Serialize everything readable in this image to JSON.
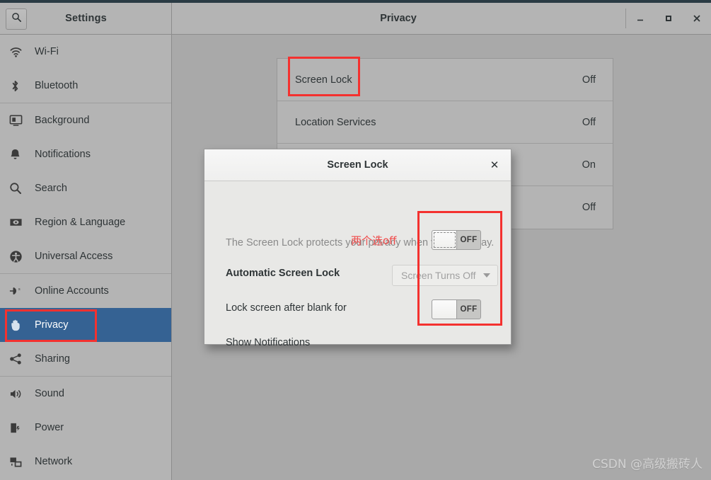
{
  "window": {
    "sidebar_title": "Settings",
    "content_title": "Privacy",
    "search_icon": "search-icon",
    "minimize_label": "–",
    "maximize_label": "□",
    "close_label": "✕"
  },
  "sidebar": {
    "items": [
      {
        "label": "Wi-Fi",
        "icon": "wifi-icon",
        "selected": false
      },
      {
        "label": "Bluetooth",
        "icon": "bluetooth-icon",
        "selected": false
      },
      {
        "label": "Background",
        "icon": "background-icon",
        "selected": false
      },
      {
        "label": "Notifications",
        "icon": "bell-icon",
        "selected": false
      },
      {
        "label": "Search",
        "icon": "search-icon",
        "selected": false
      },
      {
        "label": "Region & Language",
        "icon": "region-language-icon",
        "selected": false
      },
      {
        "label": "Universal Access",
        "icon": "universal-access-icon",
        "selected": false
      },
      {
        "label": "Online Accounts",
        "icon": "online-accounts-icon",
        "selected": false
      },
      {
        "label": "Privacy",
        "icon": "hand-icon",
        "selected": true
      },
      {
        "label": "Sharing",
        "icon": "share-icon",
        "selected": false
      },
      {
        "label": "Sound",
        "icon": "speaker-icon",
        "selected": false
      },
      {
        "label": "Power",
        "icon": "power-battery-icon",
        "selected": false
      },
      {
        "label": "Network",
        "icon": "network-icon",
        "selected": false
      }
    ]
  },
  "main": {
    "rows": [
      {
        "label": "Screen Lock",
        "value": "Off"
      },
      {
        "label": "Location Services",
        "value": "Off"
      },
      {
        "label": "",
        "value": "On"
      },
      {
        "label": "",
        "value": "Off"
      }
    ]
  },
  "dialog": {
    "title": "Screen Lock",
    "close_label": "✕",
    "description": "The Screen Lock protects your privacy when you are away.",
    "rows": {
      "automatic_screen_lock": {
        "label": "Automatic Screen Lock",
        "toggle_state": "OFF"
      },
      "lock_screen_after_blank": {
        "label": "Lock screen after blank for",
        "select_value": "Screen Turns Off"
      },
      "show_notifications": {
        "label": "Show Notifications",
        "toggle_state": "OFF"
      }
    }
  },
  "annotations": {
    "note_text": "两个选off",
    "box_color": "#f4312f",
    "boxes": [
      "screen-lock-row",
      "privacy-sidebar-item",
      "toggle-group"
    ]
  },
  "watermark": {
    "text": "CSDN @高级搬砖人"
  }
}
